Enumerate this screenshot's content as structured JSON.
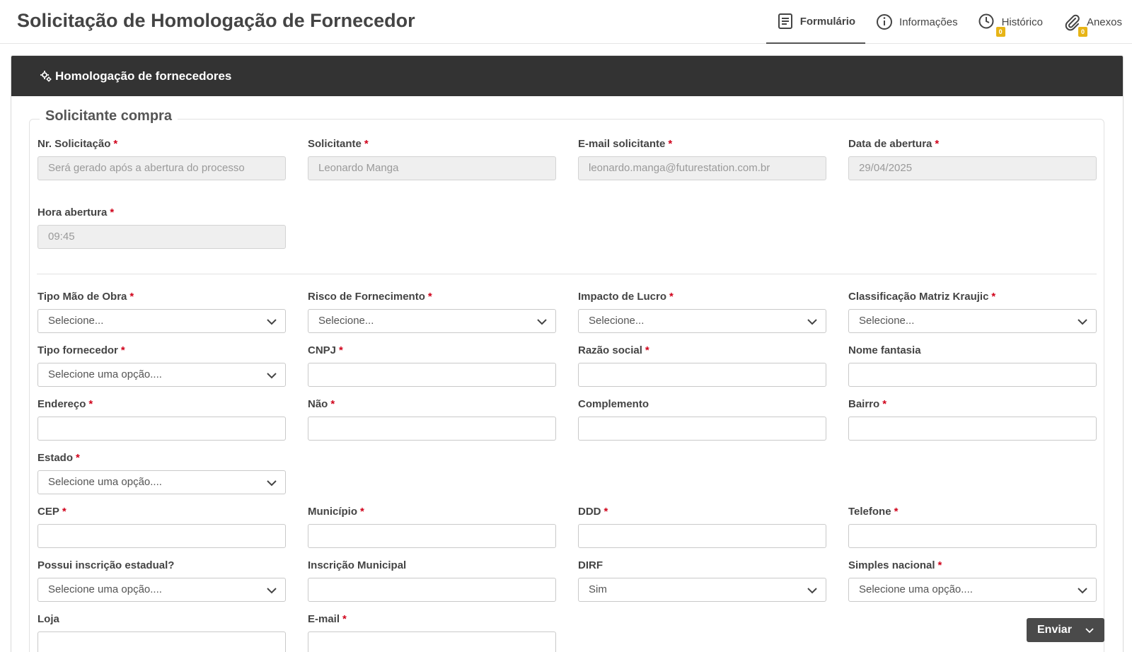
{
  "header": {
    "title": "Solicitação de Homologação de Fornecedor"
  },
  "tabs": [
    {
      "label": "Formulário",
      "icon": "form-icon",
      "active": true
    },
    {
      "label": "Informações",
      "icon": "info-icon"
    },
    {
      "label": "Histórico",
      "icon": "clock-icon",
      "badge": "0"
    },
    {
      "label": "Anexos",
      "icon": "paperclip-icon",
      "badge": "0"
    }
  ],
  "card": {
    "title": "Homologação de fornecedores",
    "icon": "cogs-icon"
  },
  "section": {
    "title": "Solicitante compra"
  },
  "fields": {
    "nr_solicitacao": {
      "label": "Nr. Solicitação",
      "required": "*",
      "placeholder": "Será gerado após a abertura do processo"
    },
    "solicitante": {
      "label": "Solicitante",
      "required": "*",
      "value": "Leonardo Manga"
    },
    "email_solicitante": {
      "label": "E-mail solicitante",
      "required": "*",
      "value": "leonardo.manga@futurestation.com.br"
    },
    "data_abertura": {
      "label": "Data de abertura",
      "required": "*",
      "value": "29/04/2025"
    },
    "hora_abertura": {
      "label": "Hora abertura",
      "required": "*",
      "value": "09:45"
    },
    "tipo_mao_obra": {
      "label": "Tipo Mão de Obra",
      "required": "*",
      "value": "Selecione..."
    },
    "risco_fornecimento": {
      "label": "Risco de Fornecimento",
      "required": "*",
      "value": "Selecione..."
    },
    "impacto_lucro": {
      "label": "Impacto de Lucro",
      "required": "*",
      "value": "Selecione..."
    },
    "matriz_kraujic": {
      "label": "Classificação Matriz Kraujic",
      "required": "*",
      "value": "Selecione..."
    },
    "tipo_fornecedor": {
      "label": "Tipo fornecedor",
      "required": "*",
      "value": "Selecione uma opção...."
    },
    "cnpj": {
      "label": "CNPJ",
      "required": "*",
      "value": ""
    },
    "razao_social": {
      "label": "Razão social",
      "required": "*",
      "value": ""
    },
    "nome_fantasia": {
      "label": "Nome fantasia",
      "value": ""
    },
    "endereco": {
      "label": "Endereço",
      "required": "*",
      "value": ""
    },
    "numero": {
      "label": "Não",
      "required": "*",
      "value": ""
    },
    "complemento": {
      "label": "Complemento",
      "value": ""
    },
    "bairro": {
      "label": "Bairro",
      "required": "*",
      "value": ""
    },
    "estado": {
      "label": "Estado",
      "required": "*",
      "value": "Selecione uma opção...."
    },
    "cep": {
      "label": "CEP",
      "required": "*",
      "value": ""
    },
    "municipio": {
      "label": "Município",
      "required": "*",
      "value": ""
    },
    "ddd": {
      "label": "DDD",
      "required": "*",
      "value": ""
    },
    "telefone": {
      "label": "Telefone",
      "required": "*",
      "value": ""
    },
    "inscricao_estadual": {
      "label": "Possui inscrição estadual?",
      "value": "Selecione uma opção...."
    },
    "inscricao_municipal": {
      "label": "Inscrição Municipal",
      "value": ""
    },
    "dirf": {
      "label": "DIRF",
      "value": "Sim"
    },
    "simples_nacional": {
      "label": "Simples nacional",
      "required": "*",
      "value": "Selecione uma opção...."
    },
    "loja": {
      "label": "Loja",
      "value": ""
    },
    "email": {
      "label": "E-mail",
      "required": "*",
      "value": ""
    }
  },
  "actions": {
    "send_label": "Enviar"
  }
}
